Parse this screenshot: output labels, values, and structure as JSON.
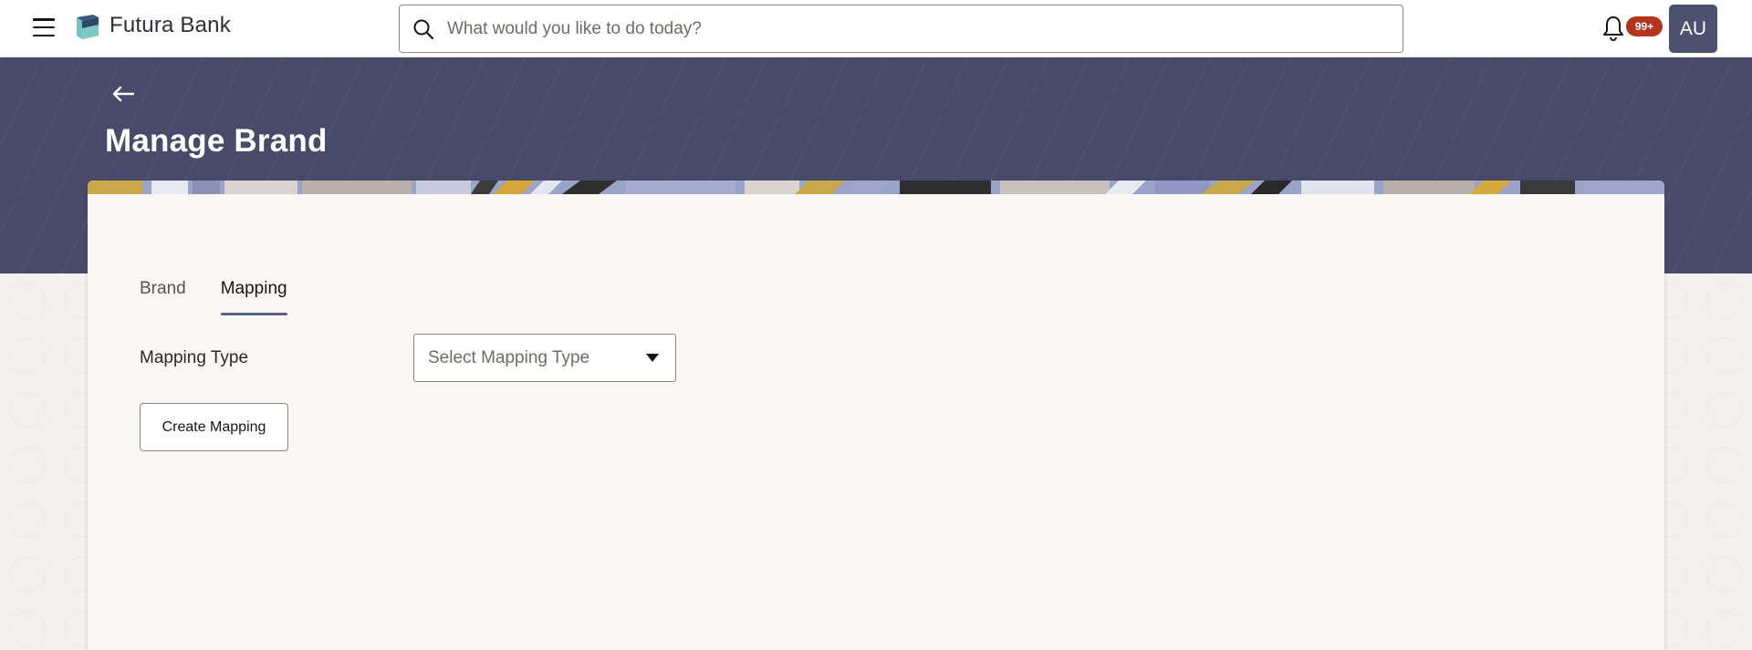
{
  "app": {
    "brand_name": "Futura Bank"
  },
  "header": {
    "search_placeholder": "What would you like to do today?",
    "notification_count": "99+",
    "avatar_initials": "AU"
  },
  "page": {
    "title": "Manage Brand"
  },
  "tabs": [
    {
      "label": "Brand",
      "active": false
    },
    {
      "label": "Mapping",
      "active": true
    }
  ],
  "form": {
    "mapping_type_label": "Mapping Type",
    "mapping_type_value": "Select Mapping Type",
    "create_button_label": "Create Mapping"
  },
  "colors": {
    "hero": "#474b69",
    "avatar": "#4c5170",
    "badge": "#b4341f",
    "tab_indicator": "#5a6287"
  },
  "icons": {
    "menu": "hamburger-menu-icon",
    "search": "search-icon",
    "notifications": "bell-icon",
    "back": "arrow-left-icon",
    "dropdown": "caret-down-icon"
  }
}
